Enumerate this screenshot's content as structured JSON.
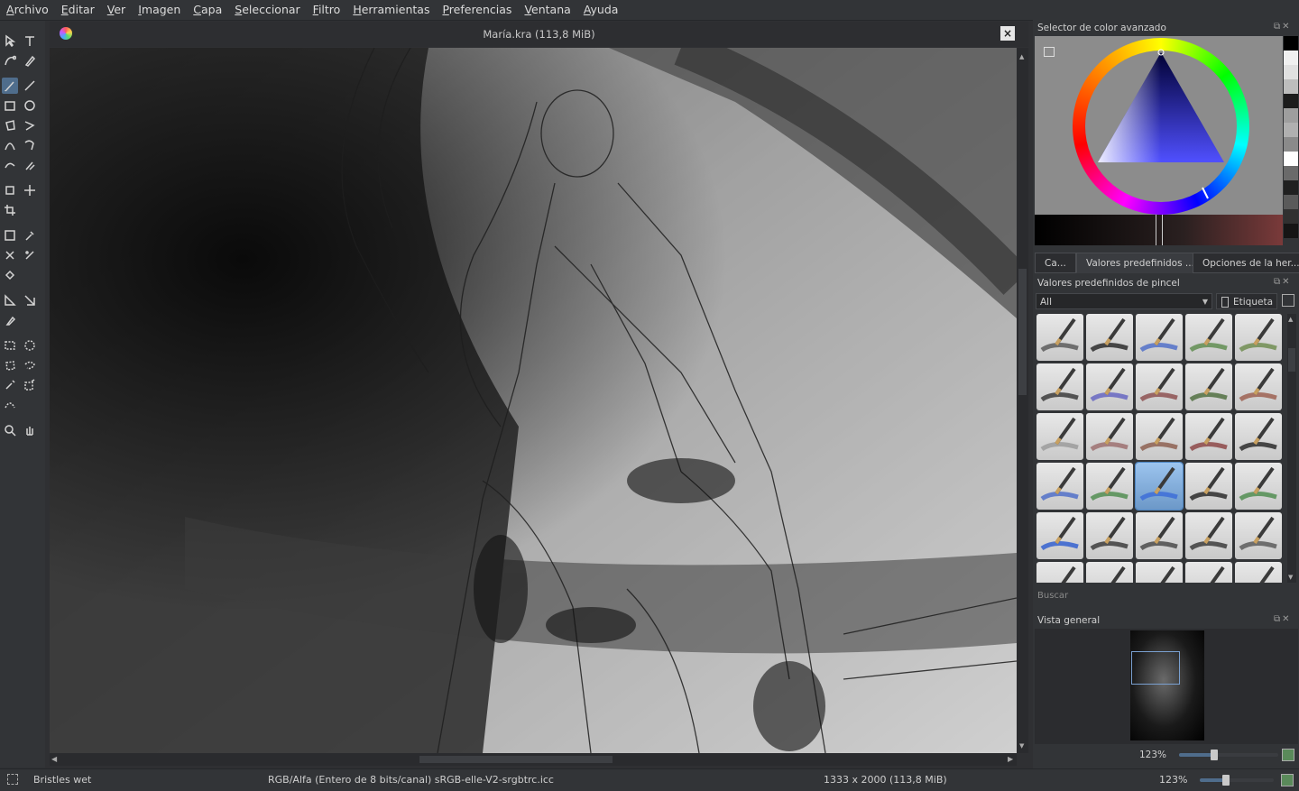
{
  "menubar": {
    "items": [
      "Archivo",
      "Editar",
      "Ver",
      "Imagen",
      "Capa",
      "Seleccionar",
      "Filtro",
      "Herramientas",
      "Preferencias",
      "Ventana",
      "Ayuda"
    ]
  },
  "toolbox": {
    "tools": [
      "select-shapes-icon",
      "text-icon",
      "edit-shapes-icon",
      "calligraphy-icon",
      "brush-icon",
      "line-icon",
      "rectangle-icon",
      "ellipse-icon",
      "polygon-icon",
      "polyline-icon",
      "bezier-icon",
      "freehand-path-icon",
      "dynamic-brush-icon",
      "multibrush-icon",
      "transform-icon",
      "move-icon",
      "crop-icon",
      "gradient-icon",
      "color-picker-icon",
      "colorize-mask-icon",
      "smart-patch-icon",
      "fill-icon",
      "assistant-icon",
      "measure-icon",
      "reference-icon",
      "rect-select-icon",
      "ellipse-select-icon",
      "polygon-select-icon",
      "freehand-select-icon",
      "contiguous-select-icon",
      "similar-select-icon",
      "bezier-select-icon",
      "zoom-icon",
      "pan-icon"
    ],
    "active_index": 4
  },
  "document": {
    "title": "María.kra (113,8 MiB)",
    "close_label": "×"
  },
  "color_selector": {
    "title": "Selector de color avanzado",
    "hue_ring": "rgb-hue-wheel",
    "triangle_hue": "#0000ff"
  },
  "tabs": [
    {
      "label": "Ca...",
      "active": false
    },
    {
      "label": "Valores predefinidos ...",
      "active": true
    },
    {
      "label": "Opciones de la her...",
      "active": false
    }
  ],
  "brush_presets": {
    "title": "Valores predefinidos de pincel",
    "filter_value": "All",
    "tag_label": "Etiqueta",
    "selected_index": 17,
    "search_label": "Buscar"
  },
  "overview": {
    "title": "Vista general",
    "zoom_label": "123%",
    "zoom_fraction": 0.35
  },
  "statusbar": {
    "brush_name": "Bristles wet",
    "color_space": "RGB/Alfa (Entero de 8 bits/canal)  sRGB-elle-V2-srgbtrc.icc",
    "image_size": "1333 x 2000 (113,8 MiB)",
    "zoom": "123%",
    "zoom_fraction": 0.35
  },
  "colors": {
    "accent": "#4f6d8c",
    "panel_bg": "#323437",
    "selection": "#6c98c8"
  }
}
